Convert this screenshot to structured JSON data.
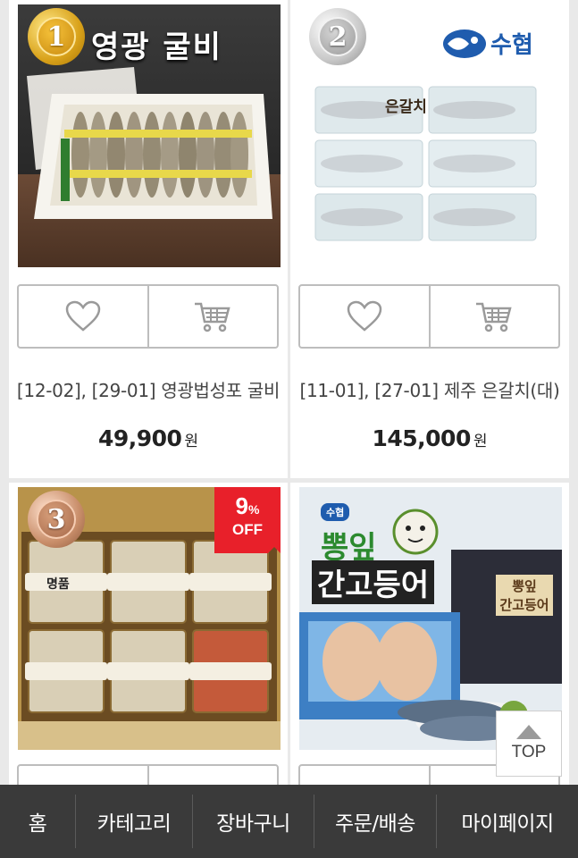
{
  "products": [
    {
      "rank": "1",
      "image_caption": "영광 굴비",
      "title": "[12-02], [29-01] 영광법성포 굴비",
      "price": "49,900",
      "currency": "원"
    },
    {
      "rank": "2",
      "brand": "수협",
      "package_label": "은갈치",
      "title": "[11-01], [27-01] 제주 은갈치(대)",
      "price": "145,000",
      "currency": "원"
    },
    {
      "rank": "3",
      "package_label": "명품",
      "discount_pct": "9",
      "discount_unit": "%",
      "discount_text": "OFF"
    },
    {
      "brand": "수협",
      "image_caption_1": "뽕잎",
      "image_caption_2": "간고등어",
      "box_label_1": "뽕잎",
      "box_label_2": "간고등어"
    }
  ],
  "top_button": {
    "label": "TOP"
  },
  "bottom_nav": [
    {
      "label": "홈"
    },
    {
      "label": "카테고리"
    },
    {
      "label": "장바구니"
    },
    {
      "label": "주문/배송"
    },
    {
      "label": "마이페이지"
    }
  ]
}
